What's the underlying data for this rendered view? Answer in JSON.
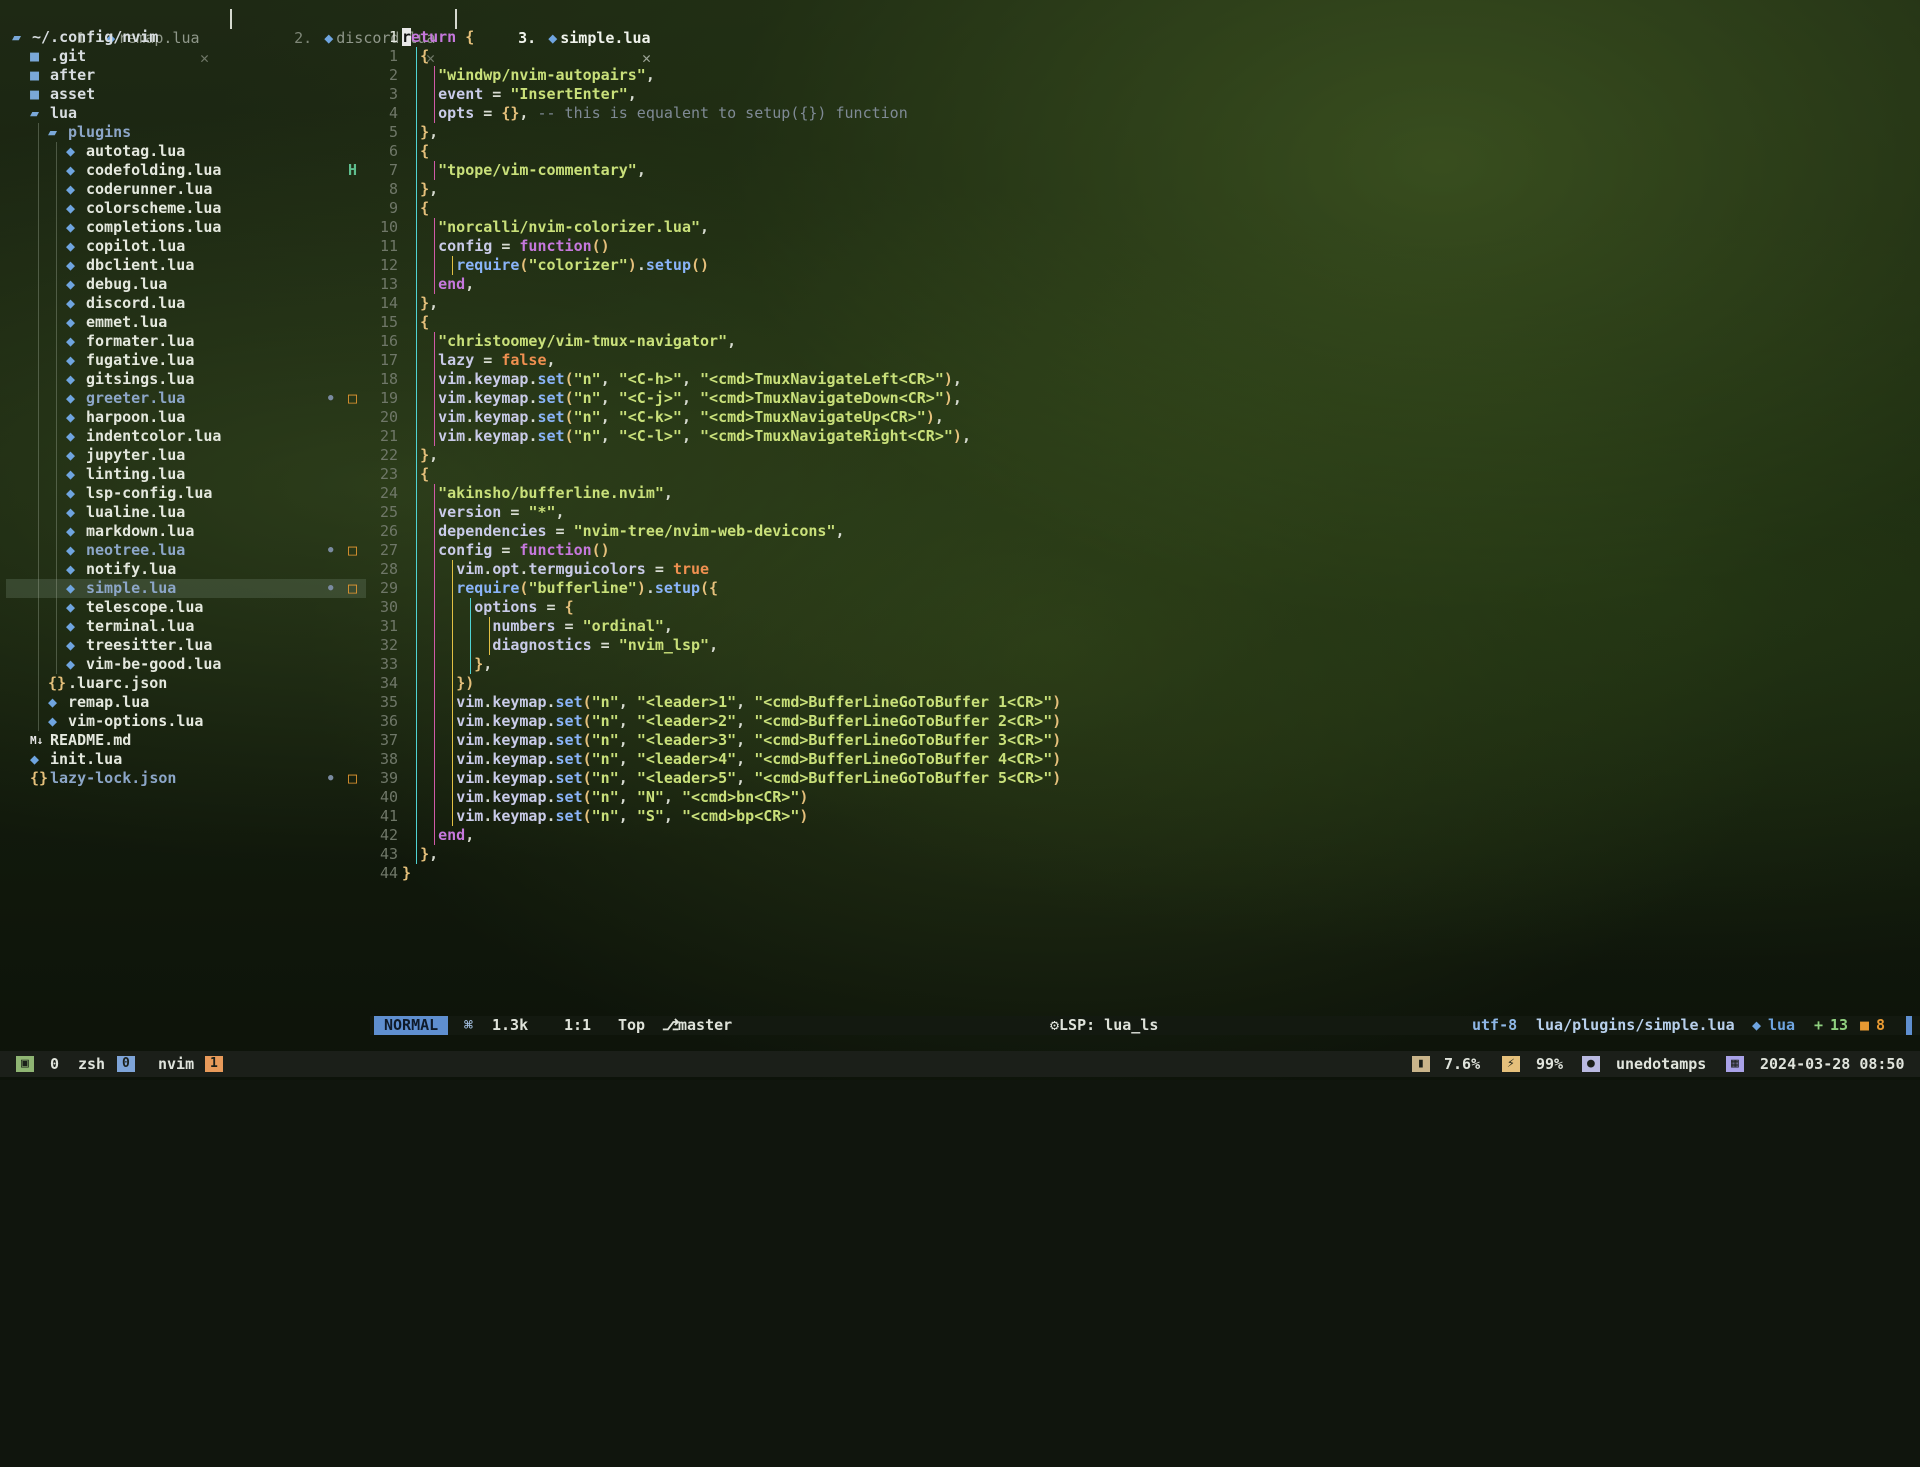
{
  "tabs": [
    {
      "num": "1.",
      "name": "remap.lua",
      "close": "✕",
      "active": false
    },
    {
      "num": "2.",
      "name": "discord.lua",
      "close": "✕",
      "active": false
    },
    {
      "num": "3.",
      "name": "simple.lua",
      "close": "✕",
      "active": true
    }
  ],
  "tree": {
    "root": "~/.config/nvim",
    "items": [
      {
        "depth": 1,
        "icon": "folder-icon",
        "name": ".git"
      },
      {
        "depth": 1,
        "icon": "folder-icon",
        "name": "after"
      },
      {
        "depth": 1,
        "icon": "folder-icon",
        "name": "asset"
      },
      {
        "depth": 1,
        "icon": "folder-open-icon",
        "name": "lua"
      },
      {
        "depth": 2,
        "icon": "folder-open-icon",
        "name": "plugins",
        "dim": true
      },
      {
        "depth": 3,
        "icon": "lua-icon",
        "name": "autotag.lua"
      },
      {
        "depth": 3,
        "icon": "lua-icon",
        "name": "codefolding.lua",
        "git": "H"
      },
      {
        "depth": 3,
        "icon": "lua-icon",
        "name": "coderunner.lua"
      },
      {
        "depth": 3,
        "icon": "lua-icon",
        "name": "colorscheme.lua"
      },
      {
        "depth": 3,
        "icon": "lua-icon",
        "name": "completions.lua"
      },
      {
        "depth": 3,
        "icon": "lua-icon",
        "name": "copilot.lua"
      },
      {
        "depth": 3,
        "icon": "lua-icon",
        "name": "dbclient.lua"
      },
      {
        "depth": 3,
        "icon": "lua-icon",
        "name": "debug.lua"
      },
      {
        "depth": 3,
        "icon": "lua-icon",
        "name": "discord.lua"
      },
      {
        "depth": 3,
        "icon": "lua-icon",
        "name": "emmet.lua"
      },
      {
        "depth": 3,
        "icon": "lua-icon",
        "name": "formater.lua"
      },
      {
        "depth": 3,
        "icon": "lua-icon",
        "name": "fugative.lua"
      },
      {
        "depth": 3,
        "icon": "lua-icon",
        "name": "gitsings.lua"
      },
      {
        "depth": 3,
        "icon": "lua-icon",
        "name": "greeter.lua",
        "dim": true,
        "modified": true
      },
      {
        "depth": 3,
        "icon": "lua-icon",
        "name": "harpoon.lua"
      },
      {
        "depth": 3,
        "icon": "lua-icon",
        "name": "indentcolor.lua"
      },
      {
        "depth": 3,
        "icon": "lua-icon",
        "name": "jupyter.lua"
      },
      {
        "depth": 3,
        "icon": "lua-icon",
        "name": "linting.lua"
      },
      {
        "depth": 3,
        "icon": "lua-icon",
        "name": "lsp-config.lua"
      },
      {
        "depth": 3,
        "icon": "lua-icon",
        "name": "lualine.lua"
      },
      {
        "depth": 3,
        "icon": "lua-icon",
        "name": "markdown.lua"
      },
      {
        "depth": 3,
        "icon": "lua-icon",
        "name": "neotree.lua",
        "dim": true,
        "modified": true
      },
      {
        "depth": 3,
        "icon": "lua-icon",
        "name": "notify.lua"
      },
      {
        "depth": 3,
        "icon": "lua-icon",
        "name": "simple.lua",
        "dim": true,
        "modified": true,
        "selected": true
      },
      {
        "depth": 3,
        "icon": "lua-icon",
        "name": "telescope.lua"
      },
      {
        "depth": 3,
        "icon": "lua-icon",
        "name": "terminal.lua"
      },
      {
        "depth": 3,
        "icon": "lua-icon",
        "name": "treesitter.lua"
      },
      {
        "depth": 3,
        "icon": "lua-icon",
        "name": "vim-be-good.lua"
      },
      {
        "depth": 2,
        "icon": "json-icon",
        "name": ".luarc.json"
      },
      {
        "depth": 2,
        "icon": "lua-icon",
        "name": "remap.lua"
      },
      {
        "depth": 2,
        "icon": "lua-icon",
        "name": "vim-options.lua"
      },
      {
        "depth": 1,
        "icon": "markdown-icon",
        "name": "README.md"
      },
      {
        "depth": 1,
        "icon": "lua-icon",
        "name": "init.lua"
      },
      {
        "depth": 1,
        "icon": "json-icon",
        "name": "lazy-lock.json",
        "dim": true,
        "modified": true
      }
    ]
  },
  "code_lines": [
    [
      [
        "kw",
        "return"
      ],
      [
        "punc",
        " "
      ],
      [
        "br",
        "{"
      ]
    ],
    [
      [
        "punc",
        "  "
      ],
      [
        "br",
        "{"
      ]
    ],
    [
      [
        "punc",
        "    "
      ],
      [
        "str",
        "\"windwp/nvim-autopairs\""
      ],
      [
        "punc",
        ","
      ]
    ],
    [
      [
        "punc",
        "    "
      ],
      [
        "key",
        "event"
      ],
      [
        "punc",
        " = "
      ],
      [
        "str",
        "\"InsertEnter\""
      ],
      [
        "punc",
        ","
      ]
    ],
    [
      [
        "punc",
        "    "
      ],
      [
        "key",
        "opts"
      ],
      [
        "punc",
        " = "
      ],
      [
        "br",
        "{}"
      ],
      [
        "punc",
        ", "
      ],
      [
        "com",
        "-- this is equalent to setup({}) function"
      ]
    ],
    [
      [
        "punc",
        "  "
      ],
      [
        "br",
        "}"
      ],
      [
        "punc",
        ","
      ]
    ],
    [
      [
        "punc",
        "  "
      ],
      [
        "br",
        "{"
      ]
    ],
    [
      [
        "punc",
        "    "
      ],
      [
        "str",
        "\"tpope/vim-commentary\""
      ],
      [
        "punc",
        ","
      ]
    ],
    [
      [
        "punc",
        "  "
      ],
      [
        "br",
        "}"
      ],
      [
        "punc",
        ","
      ]
    ],
    [
      [
        "punc",
        "  "
      ],
      [
        "br",
        "{"
      ]
    ],
    [
      [
        "punc",
        "    "
      ],
      [
        "str",
        "\"norcalli/nvim-colorizer.lua\""
      ],
      [
        "punc",
        ","
      ]
    ],
    [
      [
        "punc",
        "    "
      ],
      [
        "key",
        "config"
      ],
      [
        "punc",
        " = "
      ],
      [
        "kw",
        "function"
      ],
      [
        "br",
        "()"
      ]
    ],
    [
      [
        "punc",
        "      "
      ],
      [
        "meth",
        "require"
      ],
      [
        "br",
        "("
      ],
      [
        "str",
        "\"colorizer\""
      ],
      [
        "br",
        ")"
      ],
      [
        "punc",
        "."
      ],
      [
        "meth",
        "setup"
      ],
      [
        "br",
        "()"
      ]
    ],
    [
      [
        "punc",
        "    "
      ],
      [
        "kw",
        "end"
      ],
      [
        "punc",
        ","
      ]
    ],
    [
      [
        "punc",
        "  "
      ],
      [
        "br",
        "}"
      ],
      [
        "punc",
        ","
      ]
    ],
    [
      [
        "punc",
        "  "
      ],
      [
        "br",
        "{"
      ]
    ],
    [
      [
        "punc",
        "    "
      ],
      [
        "str",
        "\"christoomey/vim-tmux-navigator\""
      ],
      [
        "punc",
        ","
      ]
    ],
    [
      [
        "punc",
        "    "
      ],
      [
        "key",
        "lazy"
      ],
      [
        "punc",
        " = "
      ],
      [
        "bool",
        "false"
      ],
      [
        "punc",
        ","
      ]
    ],
    [
      [
        "punc",
        "    "
      ],
      [
        "var",
        "vim"
      ],
      [
        "punc",
        "."
      ],
      [
        "var",
        "keymap"
      ],
      [
        "punc",
        "."
      ],
      [
        "meth",
        "set"
      ],
      [
        "br",
        "("
      ],
      [
        "str",
        "\"n\""
      ],
      [
        "punc",
        ", "
      ],
      [
        "str",
        "\"<C-h>\""
      ],
      [
        "punc",
        ", "
      ],
      [
        "str",
        "\"<cmd>TmuxNavigateLeft<CR>\""
      ],
      [
        "br",
        ")"
      ],
      [
        "punc",
        ","
      ]
    ],
    [
      [
        "punc",
        "    "
      ],
      [
        "var",
        "vim"
      ],
      [
        "punc",
        "."
      ],
      [
        "var",
        "keymap"
      ],
      [
        "punc",
        "."
      ],
      [
        "meth",
        "set"
      ],
      [
        "br",
        "("
      ],
      [
        "str",
        "\"n\""
      ],
      [
        "punc",
        ", "
      ],
      [
        "str",
        "\"<C-j>\""
      ],
      [
        "punc",
        ", "
      ],
      [
        "str",
        "\"<cmd>TmuxNavigateDown<CR>\""
      ],
      [
        "br",
        ")"
      ],
      [
        "punc",
        ","
      ]
    ],
    [
      [
        "punc",
        "    "
      ],
      [
        "var",
        "vim"
      ],
      [
        "punc",
        "."
      ],
      [
        "var",
        "keymap"
      ],
      [
        "punc",
        "."
      ],
      [
        "meth",
        "set"
      ],
      [
        "br",
        "("
      ],
      [
        "str",
        "\"n\""
      ],
      [
        "punc",
        ", "
      ],
      [
        "str",
        "\"<C-k>\""
      ],
      [
        "punc",
        ", "
      ],
      [
        "str",
        "\"<cmd>TmuxNavigateUp<CR>\""
      ],
      [
        "br",
        ")"
      ],
      [
        "punc",
        ","
      ]
    ],
    [
      [
        "punc",
        "    "
      ],
      [
        "var",
        "vim"
      ],
      [
        "punc",
        "."
      ],
      [
        "var",
        "keymap"
      ],
      [
        "punc",
        "."
      ],
      [
        "meth",
        "set"
      ],
      [
        "br",
        "("
      ],
      [
        "str",
        "\"n\""
      ],
      [
        "punc",
        ", "
      ],
      [
        "str",
        "\"<C-l>\""
      ],
      [
        "punc",
        ", "
      ],
      [
        "str",
        "\"<cmd>TmuxNavigateRight<CR>\""
      ],
      [
        "br",
        ")"
      ],
      [
        "punc",
        ","
      ]
    ],
    [
      [
        "punc",
        "  "
      ],
      [
        "br",
        "}"
      ],
      [
        "punc",
        ","
      ]
    ],
    [
      [
        "punc",
        "  "
      ],
      [
        "br",
        "{"
      ]
    ],
    [
      [
        "punc",
        "    "
      ],
      [
        "str",
        "\"akinsho/bufferline.nvim\""
      ],
      [
        "punc",
        ","
      ]
    ],
    [
      [
        "punc",
        "    "
      ],
      [
        "key",
        "version"
      ],
      [
        "punc",
        " = "
      ],
      [
        "str",
        "\"*\""
      ],
      [
        "punc",
        ","
      ]
    ],
    [
      [
        "punc",
        "    "
      ],
      [
        "key",
        "dependencies"
      ],
      [
        "punc",
        " = "
      ],
      [
        "str",
        "\"nvim-tree/nvim-web-devicons\""
      ],
      [
        "punc",
        ","
      ]
    ],
    [
      [
        "punc",
        "    "
      ],
      [
        "key",
        "config"
      ],
      [
        "punc",
        " = "
      ],
      [
        "kw",
        "function"
      ],
      [
        "br",
        "()"
      ]
    ],
    [
      [
        "punc",
        "      "
      ],
      [
        "var",
        "vim"
      ],
      [
        "punc",
        "."
      ],
      [
        "var",
        "opt"
      ],
      [
        "punc",
        "."
      ],
      [
        "var",
        "termguicolors"
      ],
      [
        "punc",
        " = "
      ],
      [
        "bool",
        "true"
      ]
    ],
    [
      [
        "punc",
        "      "
      ],
      [
        "meth",
        "require"
      ],
      [
        "br",
        "("
      ],
      [
        "str",
        "\"bufferline\""
      ],
      [
        "br",
        ")"
      ],
      [
        "punc",
        "."
      ],
      [
        "meth",
        "setup"
      ],
      [
        "br",
        "({"
      ]
    ],
    [
      [
        "punc",
        "        "
      ],
      [
        "key",
        "options"
      ],
      [
        "punc",
        " = "
      ],
      [
        "br",
        "{"
      ]
    ],
    [
      [
        "punc",
        "          "
      ],
      [
        "key",
        "numbers"
      ],
      [
        "punc",
        " = "
      ],
      [
        "str",
        "\"ordinal\""
      ],
      [
        "punc",
        ","
      ]
    ],
    [
      [
        "punc",
        "          "
      ],
      [
        "key",
        "diagnostics"
      ],
      [
        "punc",
        " = "
      ],
      [
        "str",
        "\"nvim_lsp\""
      ],
      [
        "punc",
        ","
      ]
    ],
    [
      [
        "punc",
        "        "
      ],
      [
        "br",
        "}"
      ],
      [
        "punc",
        ","
      ]
    ],
    [
      [
        "punc",
        "      "
      ],
      [
        "br",
        "})"
      ]
    ],
    [
      [
        "punc",
        "      "
      ],
      [
        "var",
        "vim"
      ],
      [
        "punc",
        "."
      ],
      [
        "var",
        "keymap"
      ],
      [
        "punc",
        "."
      ],
      [
        "meth",
        "set"
      ],
      [
        "br",
        "("
      ],
      [
        "str",
        "\"n\""
      ],
      [
        "punc",
        ", "
      ],
      [
        "str",
        "\"<leader>1\""
      ],
      [
        "punc",
        ", "
      ],
      [
        "str",
        "\"<cmd>BufferLineGoToBuffer 1<CR>\""
      ],
      [
        "br",
        ")"
      ]
    ],
    [
      [
        "punc",
        "      "
      ],
      [
        "var",
        "vim"
      ],
      [
        "punc",
        "."
      ],
      [
        "var",
        "keymap"
      ],
      [
        "punc",
        "."
      ],
      [
        "meth",
        "set"
      ],
      [
        "br",
        "("
      ],
      [
        "str",
        "\"n\""
      ],
      [
        "punc",
        ", "
      ],
      [
        "str",
        "\"<leader>2\""
      ],
      [
        "punc",
        ", "
      ],
      [
        "str",
        "\"<cmd>BufferLineGoToBuffer 2<CR>\""
      ],
      [
        "br",
        ")"
      ]
    ],
    [
      [
        "punc",
        "      "
      ],
      [
        "var",
        "vim"
      ],
      [
        "punc",
        "."
      ],
      [
        "var",
        "keymap"
      ],
      [
        "punc",
        "."
      ],
      [
        "meth",
        "set"
      ],
      [
        "br",
        "("
      ],
      [
        "str",
        "\"n\""
      ],
      [
        "punc",
        ", "
      ],
      [
        "str",
        "\"<leader>3\""
      ],
      [
        "punc",
        ", "
      ],
      [
        "str",
        "\"<cmd>BufferLineGoToBuffer 3<CR>\""
      ],
      [
        "br",
        ")"
      ]
    ],
    [
      [
        "punc",
        "      "
      ],
      [
        "var",
        "vim"
      ],
      [
        "punc",
        "."
      ],
      [
        "var",
        "keymap"
      ],
      [
        "punc",
        "."
      ],
      [
        "meth",
        "set"
      ],
      [
        "br",
        "("
      ],
      [
        "str",
        "\"n\""
      ],
      [
        "punc",
        ", "
      ],
      [
        "str",
        "\"<leader>4\""
      ],
      [
        "punc",
        ", "
      ],
      [
        "str",
        "\"<cmd>BufferLineGoToBuffer 4<CR>\""
      ],
      [
        "br",
        ")"
      ]
    ],
    [
      [
        "punc",
        "      "
      ],
      [
        "var",
        "vim"
      ],
      [
        "punc",
        "."
      ],
      [
        "var",
        "keymap"
      ],
      [
        "punc",
        "."
      ],
      [
        "meth",
        "set"
      ],
      [
        "br",
        "("
      ],
      [
        "str",
        "\"n\""
      ],
      [
        "punc",
        ", "
      ],
      [
        "str",
        "\"<leader>5\""
      ],
      [
        "punc",
        ", "
      ],
      [
        "str",
        "\"<cmd>BufferLineGoToBuffer 5<CR>\""
      ],
      [
        "br",
        ")"
      ]
    ],
    [
      [
        "punc",
        "      "
      ],
      [
        "var",
        "vim"
      ],
      [
        "punc",
        "."
      ],
      [
        "var",
        "keymap"
      ],
      [
        "punc",
        "."
      ],
      [
        "meth",
        "set"
      ],
      [
        "br",
        "("
      ],
      [
        "str",
        "\"n\""
      ],
      [
        "punc",
        ", "
      ],
      [
        "str",
        "\"N\""
      ],
      [
        "punc",
        ", "
      ],
      [
        "str",
        "\"<cmd>bn<CR>\""
      ],
      [
        "br",
        ")"
      ]
    ],
    [
      [
        "punc",
        "      "
      ],
      [
        "var",
        "vim"
      ],
      [
        "punc",
        "."
      ],
      [
        "var",
        "keymap"
      ],
      [
        "punc",
        "."
      ],
      [
        "meth",
        "set"
      ],
      [
        "br",
        "("
      ],
      [
        "str",
        "\"n\""
      ],
      [
        "punc",
        ", "
      ],
      [
        "str",
        "\"S\""
      ],
      [
        "punc",
        ", "
      ],
      [
        "str",
        "\"<cmd>bp<CR>\""
      ],
      [
        "br",
        ")"
      ]
    ],
    [
      [
        "punc",
        "    "
      ],
      [
        "kw",
        "end"
      ],
      [
        "punc",
        ","
      ]
    ],
    [
      [
        "punc",
        "  "
      ],
      [
        "br",
        "}"
      ],
      [
        "punc",
        ","
      ]
    ],
    [
      [
        "br",
        "}"
      ]
    ]
  ],
  "line_numbers": [
    "1",
    "1",
    "2",
    "3",
    "4",
    "5",
    "6",
    "7",
    "8",
    "9",
    "10",
    "11",
    "12",
    "13",
    "14",
    "15",
    "16",
    "17",
    "18",
    "19",
    "20",
    "21",
    "22",
    "23",
    "24",
    "25",
    "26",
    "27",
    "28",
    "29",
    "30",
    "31",
    "32",
    "33",
    "34",
    "35",
    "36",
    "37",
    "38",
    "39",
    "40",
    "41",
    "42",
    "43",
    "44"
  ],
  "statusline": {
    "mode": "NORMAL",
    "size_icon": "⌘",
    "size": "1.3k",
    "position": "1:1",
    "scroll": "Top",
    "branch_icon": "⎇",
    "branch": "master",
    "lsp": "⚙LSP: lua_ls",
    "encoding": "utf-8",
    "path": "lua/plugins/simple.lua",
    "filetype": "lua",
    "added_icon": "+",
    "added": "13",
    "changed": "8"
  },
  "tmux": {
    "session_icon": "▣",
    "session_num": "0",
    "session_name": "zsh",
    "window0_badge": "0",
    "window1_name": "nvim",
    "window1_badge": "1",
    "cpu_icon": "▮",
    "cpu": "7.6%",
    "battery_icon": "⚡",
    "battery": "99%",
    "user_icon": "●",
    "user": "unedotamps",
    "date_icon": "▦",
    "datetime": "2024-03-28 08:50"
  },
  "colors": {
    "mode_bg": "#5f8fd0",
    "keyword": "#c678dd",
    "string": "#c9e07a",
    "boolean": "#f09050"
  }
}
